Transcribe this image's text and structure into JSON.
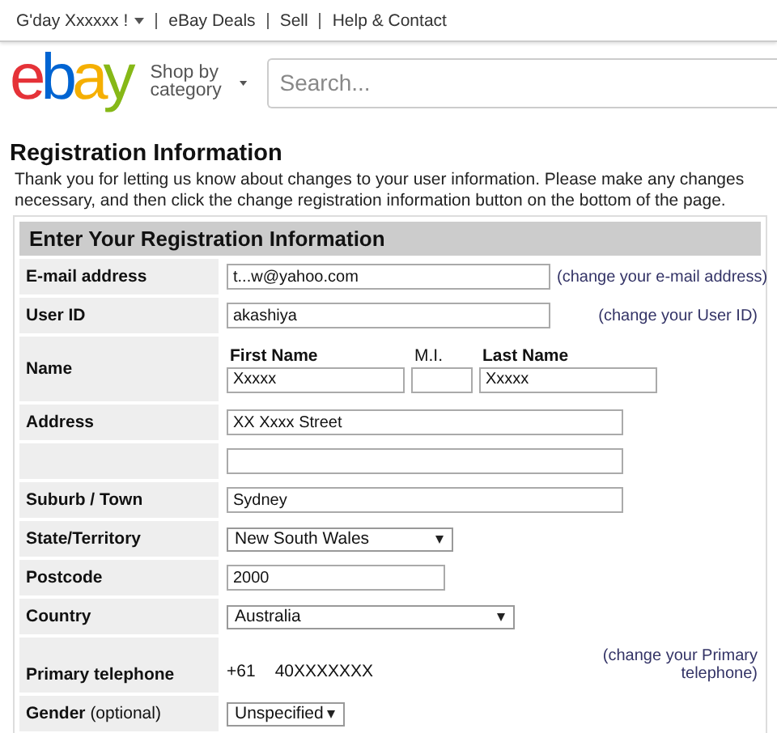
{
  "top_nav": {
    "greeting": "G'day Xxxxxx !",
    "links": [
      "eBay Deals",
      "Sell",
      "Help & Contact"
    ]
  },
  "header": {
    "logo": [
      {
        "text": "e",
        "color": "#e53238"
      },
      {
        "text": "b",
        "color": "#0064d2"
      },
      {
        "text": "a",
        "color": "#f5af02"
      },
      {
        "text": "y",
        "color": "#86b817"
      }
    ],
    "shop_by": "Shop by category",
    "search": {
      "placeholder": "Search..."
    }
  },
  "page": {
    "title": "Registration Information",
    "intro": "Thank you for letting us know about changes to your user information. Please make any changes necessary, and then click the change registration information button on the bottom of the page."
  },
  "form": {
    "heading": "Enter Your Registration Information",
    "rows": [
      {
        "kind": "input",
        "label": "E-mail address",
        "value": "t...w@yahoo.com",
        "link": "(change your e-mail address)"
      },
      {
        "kind": "input",
        "label": "User ID",
        "value": "akashiya",
        "link": "(change your User ID)"
      },
      {
        "kind": "name",
        "label": "Name",
        "parts": [
          {
            "label": "First Name",
            "value": "Xxxxx"
          },
          {
            "label": "M.I."
          },
          {
            "label": "Last Name",
            "value": "Xxxxx"
          }
        ]
      },
      {
        "kind": "input",
        "label": "Address",
        "value": "XX Xxxx Street"
      },
      {
        "kind": "input"
      },
      {
        "kind": "input",
        "label": "Suburb / Town",
        "value": "Sydney"
      },
      {
        "kind": "select",
        "label": "State/Territory",
        "value": "New South Wales"
      },
      {
        "kind": "input",
        "label": "Postcode",
        "value": "2000"
      },
      {
        "kind": "select",
        "label": "Country",
        "value": "Australia"
      },
      {
        "kind": "static",
        "label": "Primary telephone",
        "code": "+61",
        "value": "40XXXXXXX",
        "link": "(change your Primary telephone)"
      },
      {
        "kind": "select",
        "label": "Gender",
        "note": "(optional)",
        "value": "Unspecified"
      }
    ]
  }
}
